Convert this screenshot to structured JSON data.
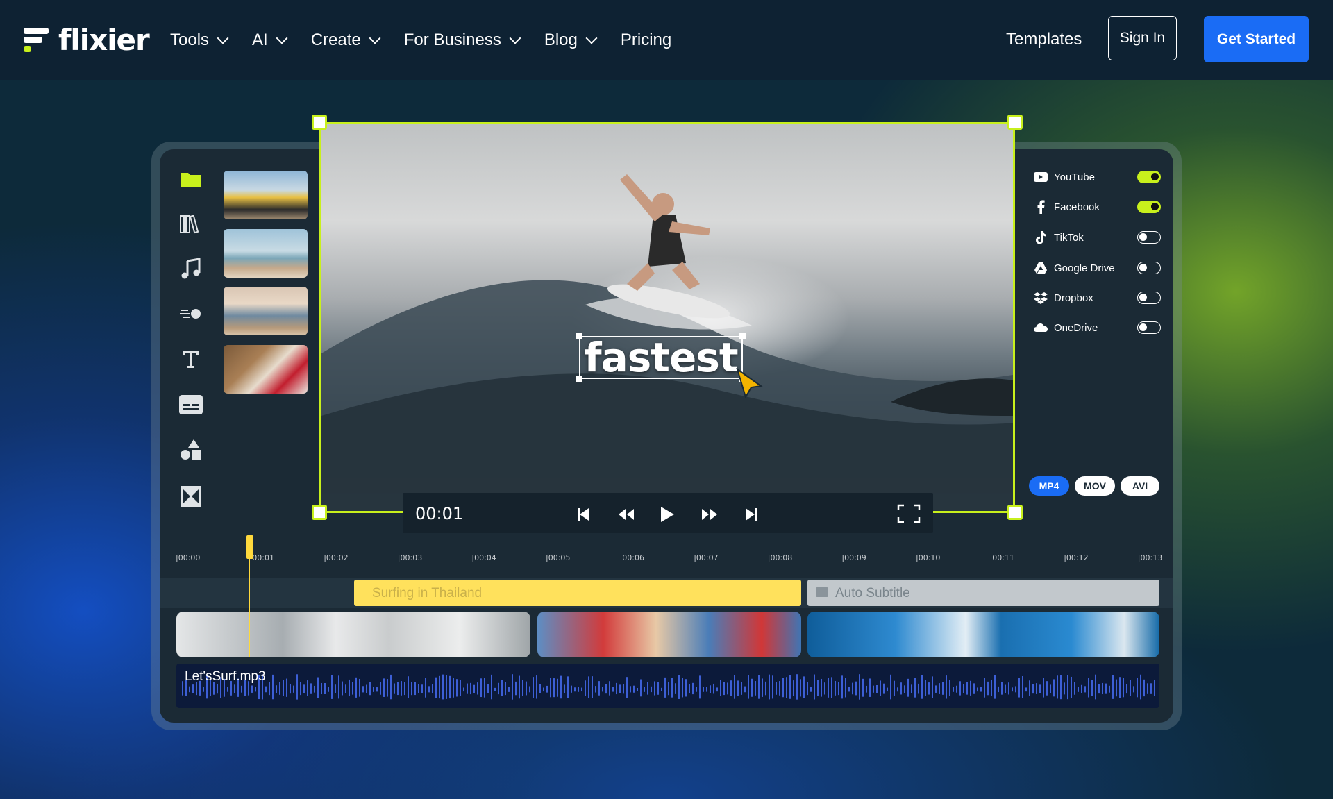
{
  "brand": {
    "name": "flixier"
  },
  "nav": {
    "items": [
      {
        "label": "Tools",
        "dropdown": true
      },
      {
        "label": "AI",
        "dropdown": true
      },
      {
        "label": "Create",
        "dropdown": true
      },
      {
        "label": "For Business",
        "dropdown": true
      },
      {
        "label": "Blog",
        "dropdown": true
      },
      {
        "label": "Pricing",
        "dropdown": false
      }
    ],
    "templates": "Templates",
    "sign_in": "Sign In",
    "get_started": "Get Started"
  },
  "editor": {
    "sidebar_icons": [
      "folder-icon",
      "library-icon",
      "music-icon",
      "motion-icon",
      "text-icon",
      "subtitles-icon",
      "shapes-icon",
      "transitions-icon"
    ],
    "thumbnails": [
      "surf-car-thumbnail",
      "surfers-beach-thumbnail",
      "surfers-walking-thumbnail",
      "red-surfboard-thumbnail"
    ],
    "caption": "fastest",
    "timecode": "00:01",
    "share_targets": [
      {
        "label": "YouTube",
        "icon": "youtube-icon",
        "enabled": true
      },
      {
        "label": "Facebook",
        "icon": "facebook-icon",
        "enabled": true
      },
      {
        "label": "TikTok",
        "icon": "tiktok-icon",
        "enabled": false
      },
      {
        "label": "Google Drive",
        "icon": "google-drive-icon",
        "enabled": false
      },
      {
        "label": "Dropbox",
        "icon": "dropbox-icon",
        "enabled": false
      },
      {
        "label": "OneDrive",
        "icon": "onedrive-icon",
        "enabled": false
      }
    ],
    "formats": [
      "MP4",
      "MOV",
      "AVI"
    ],
    "selected_format": "MP4",
    "ruler": [
      "|00:00",
      "|00:01",
      "|00:02",
      "|00:03",
      "|00:04",
      "|00:05",
      "|00:06",
      "|00:07",
      "|00:08",
      "|00:09",
      "|00:10",
      "|00:11",
      "|00:12",
      "|00:13"
    ],
    "subtitle_track": "Surfing in Thailand",
    "auto_subtitle": "Auto Subtitle",
    "audio_file": "Let'sSurf.mp3"
  },
  "colors": {
    "accent": "#c8f01c",
    "primary": "#1a6cf5",
    "subtitle_track": "#ffe15c"
  }
}
